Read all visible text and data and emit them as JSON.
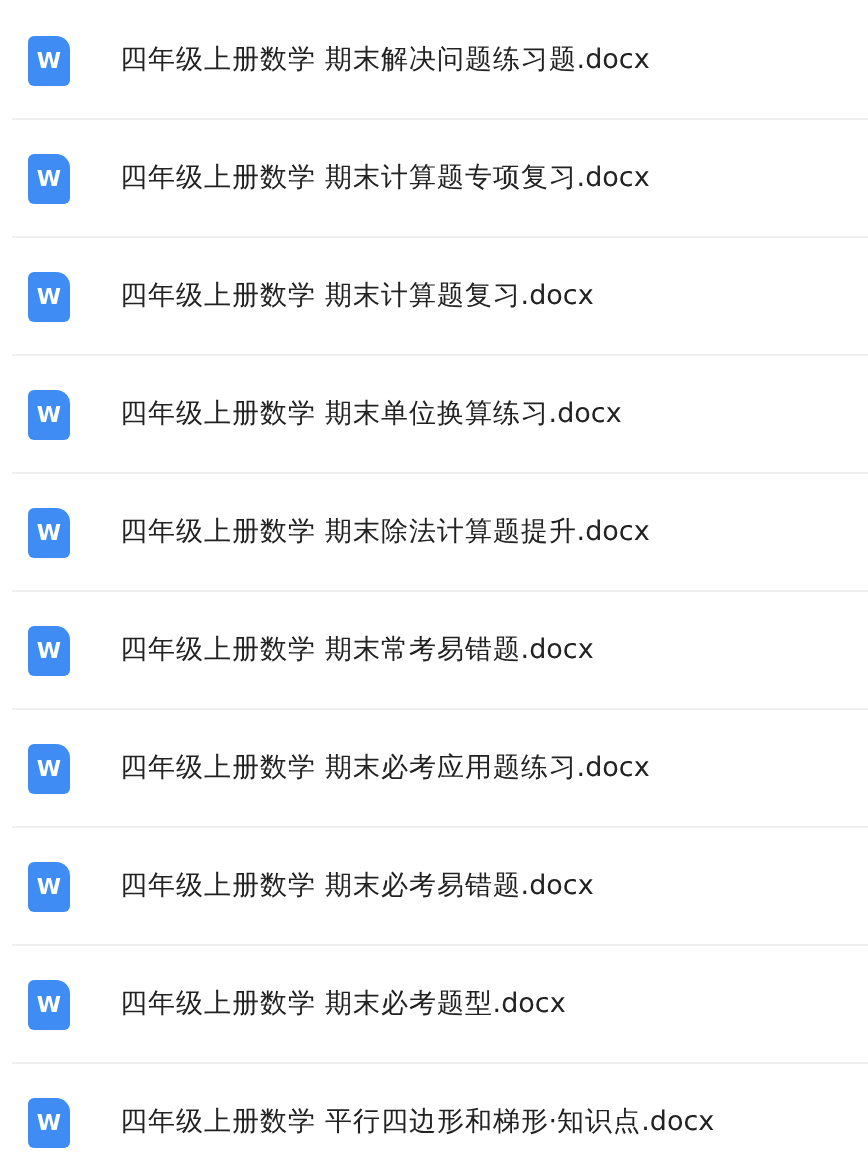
{
  "files": [
    {
      "icon_letter": "W",
      "name": "四年级上册数学 期末解决问题练习题.docx"
    },
    {
      "icon_letter": "W",
      "name": "四年级上册数学 期末计算题专项复习.docx"
    },
    {
      "icon_letter": "W",
      "name": "四年级上册数学 期末计算题复习.docx"
    },
    {
      "icon_letter": "W",
      "name": "四年级上册数学 期末单位换算练习.docx"
    },
    {
      "icon_letter": "W",
      "name": "四年级上册数学 期末除法计算题提升.docx"
    },
    {
      "icon_letter": "W",
      "name": "四年级上册数学 期末常考易错题.docx"
    },
    {
      "icon_letter": "W",
      "name": "四年级上册数学 期末必考应用题练习.docx"
    },
    {
      "icon_letter": "W",
      "name": "四年级上册数学 期末必考易错题.docx"
    },
    {
      "icon_letter": "W",
      "name": "四年级上册数学 期末必考题型.docx"
    },
    {
      "icon_letter": "W",
      "name": "四年级上册数学 平行四边形和梯形·知识点.docx"
    }
  ]
}
